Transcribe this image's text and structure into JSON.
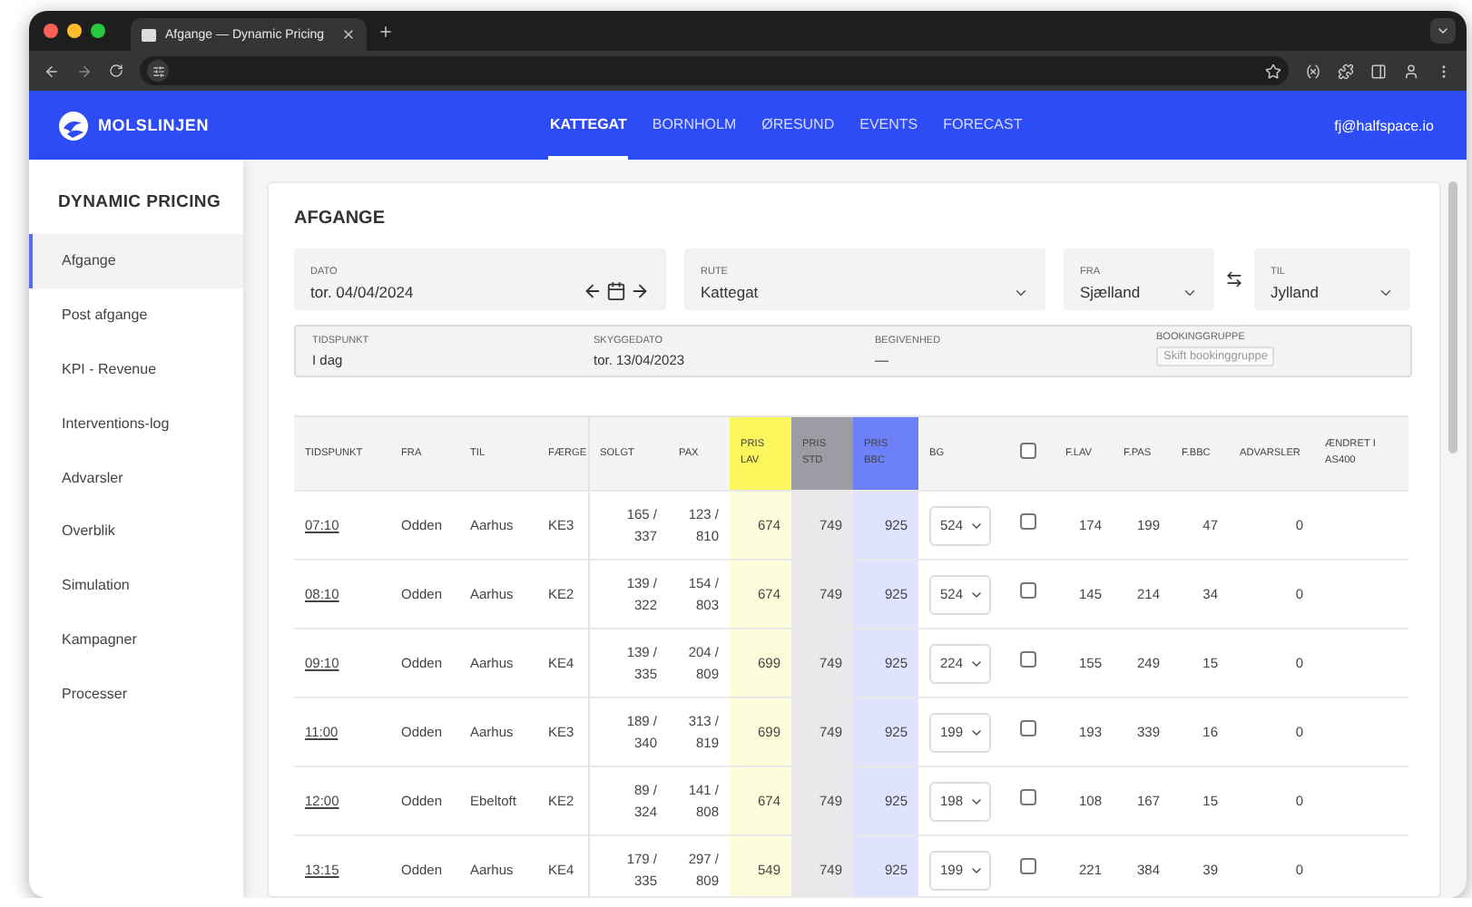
{
  "browser": {
    "tab_title": "Afgange — Dynamic Pricing"
  },
  "app": {
    "logo_text": "MOLSLINJEN",
    "user": "fj@halfspace.io",
    "nav": [
      {
        "label": "KATTEGAT",
        "selected": true
      },
      {
        "label": "BORNHOLM",
        "selected": false
      },
      {
        "label": "ØRESUND",
        "selected": false
      },
      {
        "label": "EVENTS",
        "selected": false
      },
      {
        "label": "FORECAST",
        "selected": false
      }
    ]
  },
  "sidebar": {
    "title": "DYNAMIC PRICING",
    "items": [
      {
        "label": "Afgange",
        "selected": true
      },
      {
        "label": "Post afgange",
        "selected": false
      },
      {
        "label": "KPI - Revenue",
        "selected": false
      },
      {
        "label": "Interventions-log",
        "selected": false
      },
      {
        "label": "Advarsler",
        "selected": false
      },
      {
        "label": "Overblik",
        "selected": false
      },
      {
        "label": "Simulation",
        "selected": false
      },
      {
        "label": "Kampagner",
        "selected": false
      },
      {
        "label": "Processer",
        "selected": false
      }
    ]
  },
  "page": {
    "title": "AFGANGE",
    "date": {
      "label": "DATO",
      "value": "tor. 04/04/2024"
    },
    "route": {
      "label": "RUTE",
      "value": "Kattegat"
    },
    "from": {
      "label": "FRA",
      "value": "Sjælland"
    },
    "to": {
      "label": "TIL",
      "value": "Jylland"
    },
    "info": [
      {
        "label": "TIDSPUNKT",
        "value": "I dag"
      },
      {
        "label": "SKYGGEDATO",
        "value": "tor. 13/04/2023"
      },
      {
        "label": "BEGIVENHED",
        "value": "—"
      }
    ],
    "booking_group": {
      "label": "BOOKINGGRUPPE",
      "button": "Skift bookinggruppe"
    }
  },
  "table": {
    "columns": [
      {
        "label": "TIDSPUNKT",
        "kind": "link"
      },
      {
        "label": "FRA",
        "kind": "text"
      },
      {
        "label": "TIL",
        "kind": "text"
      },
      {
        "label": "FÆRGE",
        "kind": "text"
      },
      {
        "label": "SOLGT",
        "kind": "number"
      },
      {
        "label": "PAX",
        "kind": "number"
      },
      {
        "label": "PRIS LAV",
        "kind": "number",
        "color": "#fbf65c"
      },
      {
        "label": "PRIS STD",
        "kind": "number",
        "color": "#9c9da4"
      },
      {
        "label": "PRIS BBC",
        "kind": "number",
        "color": "#6c80f7"
      },
      {
        "label": "BG",
        "kind": "select"
      },
      {
        "kind": "checkbox",
        "checked": false
      },
      {
        "label": "F.LAV",
        "kind": "number"
      },
      {
        "label": "F.PAS",
        "kind": "number"
      },
      {
        "label": "F.BBC",
        "kind": "number"
      },
      {
        "label": "ADVARSLER",
        "kind": "number"
      },
      {
        "label": "ÆNDRET I AS400",
        "kind": "text"
      }
    ],
    "rows": [
      {
        "cells": [
          "07:10",
          "Odden",
          "Aarhus",
          "KE3",
          "165 / 337",
          "123 / 810",
          "674",
          "749",
          "925",
          "524",
          {
            "checked": false
          },
          "174",
          "199",
          "47",
          "0"
        ]
      },
      {
        "cells": [
          "08:10",
          "Odden",
          "Aarhus",
          "KE2",
          "139 / 322",
          "154 / 803",
          "674",
          "749",
          "925",
          "524",
          {
            "checked": false
          },
          "145",
          "214",
          "34",
          "0"
        ]
      },
      {
        "cells": [
          "09:10",
          "Odden",
          "Aarhus",
          "KE4",
          "139 / 335",
          "204 / 809",
          "699",
          "749",
          "925",
          "224",
          {
            "checked": false
          },
          "155",
          "249",
          "15",
          "0"
        ]
      },
      {
        "cells": [
          "11:00",
          "Odden",
          "Aarhus",
          "KE3",
          "189 / 340",
          "313 / 819",
          "699",
          "749",
          "925",
          "199",
          {
            "checked": false
          },
          "193",
          "339",
          "16",
          "0"
        ]
      },
      {
        "cells": [
          "12:00",
          "Odden",
          "Ebeltoft",
          "KE2",
          "89 / 324",
          "141 / 808",
          "674",
          "749",
          "925",
          "198",
          {
            "checked": false
          },
          "108",
          "167",
          "15",
          "0"
        ]
      },
      {
        "cells": [
          "13:15",
          "Odden",
          "Aarhus",
          "KE4",
          "179 / 335",
          "297 / 809",
          "549",
          "749",
          "925",
          "199",
          {
            "checked": false
          },
          "221",
          "384",
          "39",
          "0"
        ]
      }
    ]
  }
}
